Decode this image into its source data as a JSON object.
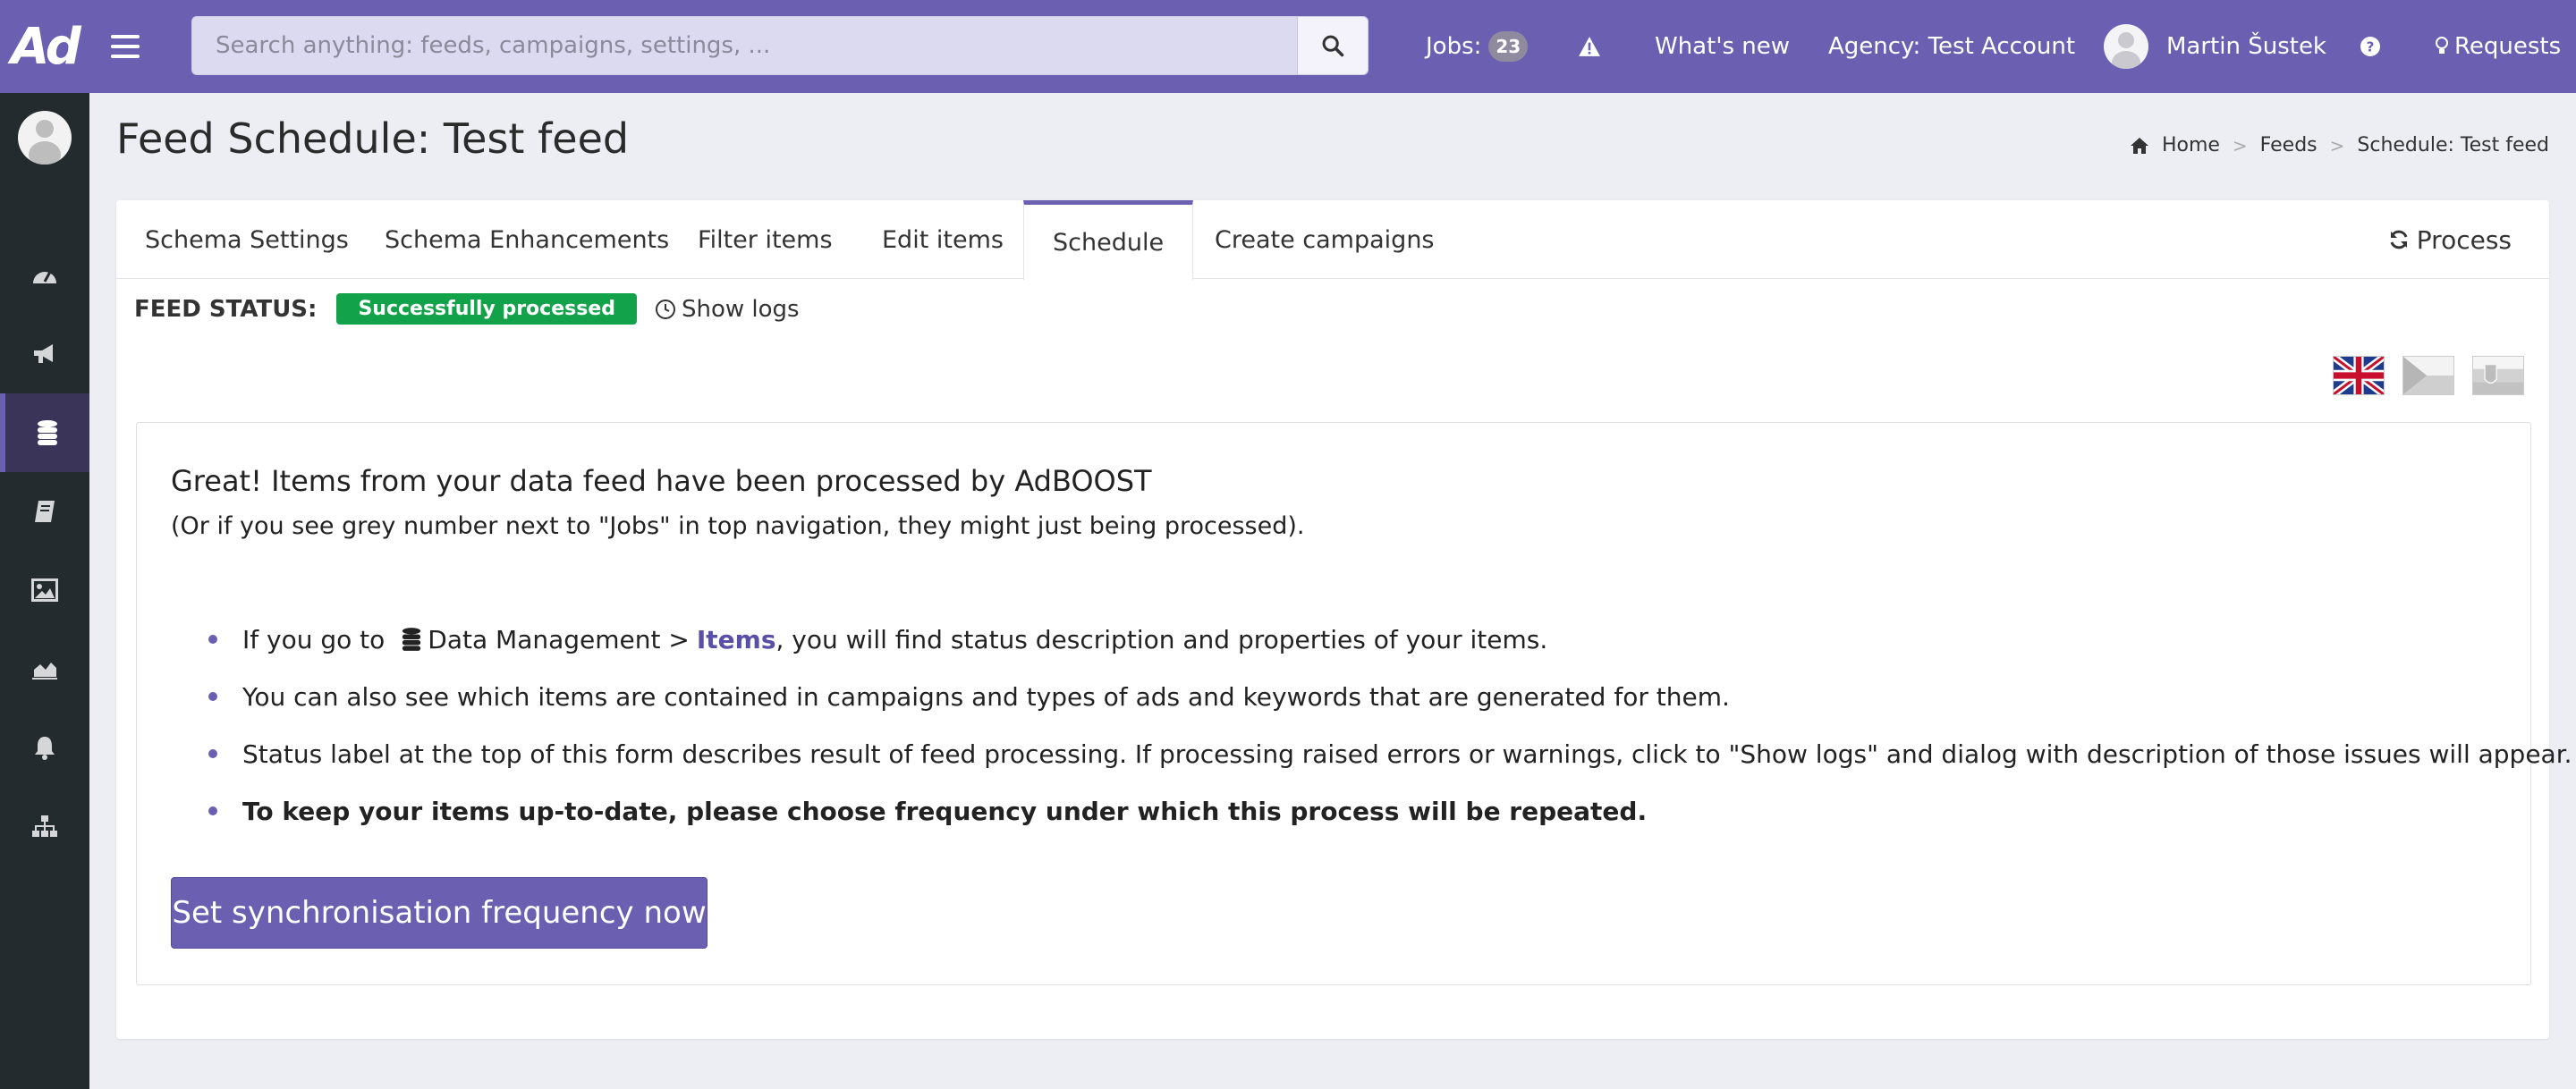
{
  "app": {
    "logo_text": "Ad",
    "colors": {
      "brand": "#6b5fb2",
      "sidebar": "#232b2e",
      "success": "#12a34a"
    }
  },
  "topbar": {
    "search_placeholder": "Search anything: feeds, campaigns, settings, ...",
    "jobs_label": "Jobs:",
    "jobs_count": "23",
    "whats_new": "What's new",
    "agency": "Agency: Test Account",
    "user_name": "Martin Šustek",
    "requests": "Requests"
  },
  "sidebar": {
    "items": [
      {
        "icon": "dashboard-icon"
      },
      {
        "icon": "megaphone-icon"
      },
      {
        "icon": "database-icon",
        "active": true
      },
      {
        "icon": "book-icon"
      },
      {
        "icon": "image-icon"
      },
      {
        "icon": "area-chart-icon"
      },
      {
        "icon": "bell-icon"
      },
      {
        "icon": "sitemap-icon"
      }
    ]
  },
  "page": {
    "title": "Feed Schedule: Test feed",
    "breadcrumb": {
      "home": "Home",
      "feeds": "Feeds",
      "current": "Schedule: Test feed"
    }
  },
  "tabs": [
    {
      "label": "Schema Settings"
    },
    {
      "label": "Schema Enhancements"
    },
    {
      "label": "Filter items"
    },
    {
      "label": "Edit items"
    },
    {
      "label": "Schedule",
      "active": true
    },
    {
      "label": "Create campaigns"
    }
  ],
  "process_label": "Process",
  "feed_status": {
    "label": "FEED STATUS:",
    "badge": "Successfully processed",
    "show_logs": "Show logs"
  },
  "languages": [
    "English",
    "Czech",
    "Slovak"
  ],
  "message": {
    "title": "Great! Items from your data feed have been processed by AdBOOST",
    "subtitle": "(Or if you see grey number next to \"Jobs\" in top navigation, they might just being processed).",
    "bullet1": {
      "prefix": "If you go to",
      "menu": "Data Management >",
      "link": "Items",
      "suffix": ", you will find status description and properties of your items."
    },
    "bullet2": "You can also see which items are contained in campaigns and types of ads and keywords that are generated for them.",
    "bullet3": "Status label at the top of this form describes result of feed processing. If processing raised errors or warnings, click to \"Show logs\" and dialog with description of those issues will appear.",
    "bullet4": "To keep your items up-to-date, please choose frequency under which this process will be repeated.",
    "button": "Set synchronisation frequency now"
  }
}
